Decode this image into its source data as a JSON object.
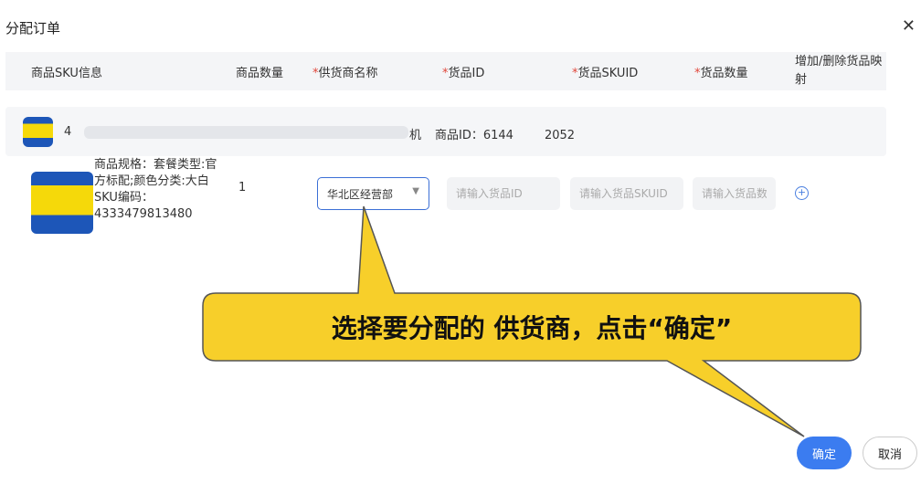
{
  "dialog": {
    "title": "分配订单",
    "close_icon": "close-icon"
  },
  "columns": {
    "sku_info": "商品SKU信息",
    "qty": "商品数量",
    "supplier": "供货商名称",
    "goods_id": "货品ID",
    "goods_skuid": "货品SKUID",
    "goods_qty": "货品数量",
    "mapping": "增加/删除货品映射",
    "required_mark": "*"
  },
  "product": {
    "name_prefix": "4",
    "name_suffix": "机",
    "id_label": "商品ID：",
    "id_prefix": "6144",
    "id_suffix": "2052"
  },
  "sku": {
    "spec": "商品规格：套餐类型:官方标配;颜色分类:大白",
    "code": "SKU编码：4333479813480",
    "quantity": "1",
    "supplier_value": "华北区经营部",
    "goods_id_placeholder": "请输入货品ID",
    "goods_skuid_placeholder": "请输入货品SKUID",
    "goods_qty_placeholder": "请输入货品数"
  },
  "callout": {
    "text": "选择要分配的 供货商，点击“确定”",
    "color": "#f7cf2a"
  },
  "buttons": {
    "confirm": "确定",
    "cancel": "取消"
  },
  "colors": {
    "primary": "#3b7cf0"
  }
}
